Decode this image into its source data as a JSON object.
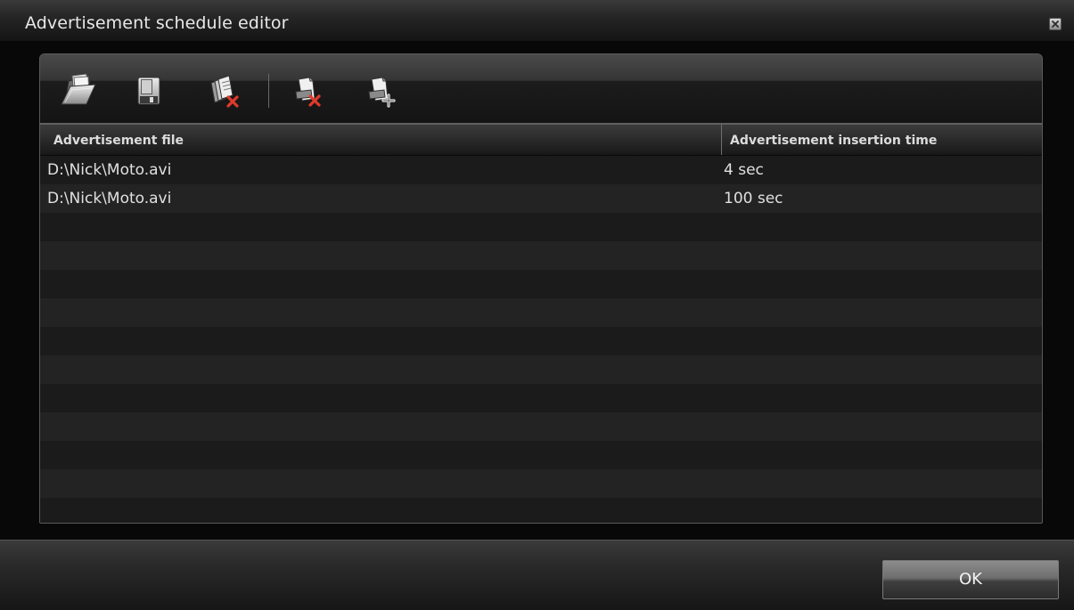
{
  "window": {
    "title": "Advertisement schedule editor"
  },
  "toolbar": {
    "buttons": [
      {
        "icon": "open-folder-icon"
      },
      {
        "icon": "save-disk-icon"
      },
      {
        "icon": "clear-all-icon"
      },
      {
        "icon": "remove-item-icon"
      },
      {
        "icon": "add-item-icon"
      }
    ]
  },
  "table": {
    "columns": [
      "Advertisement file",
      "Advertisement insertion time"
    ],
    "rows": [
      {
        "file": "D:\\Nick\\Moto.avi",
        "time": "4 sec"
      },
      {
        "file": "D:\\Nick\\Moto.avi",
        "time": "100 sec"
      }
    ]
  },
  "footer": {
    "ok_label": "OK"
  },
  "colors": {
    "background": "#080808",
    "row_dark": "#1b1b1b",
    "row_light": "#232323",
    "delete_accent": "#e03a2a",
    "text": "#e0e0e0"
  }
}
